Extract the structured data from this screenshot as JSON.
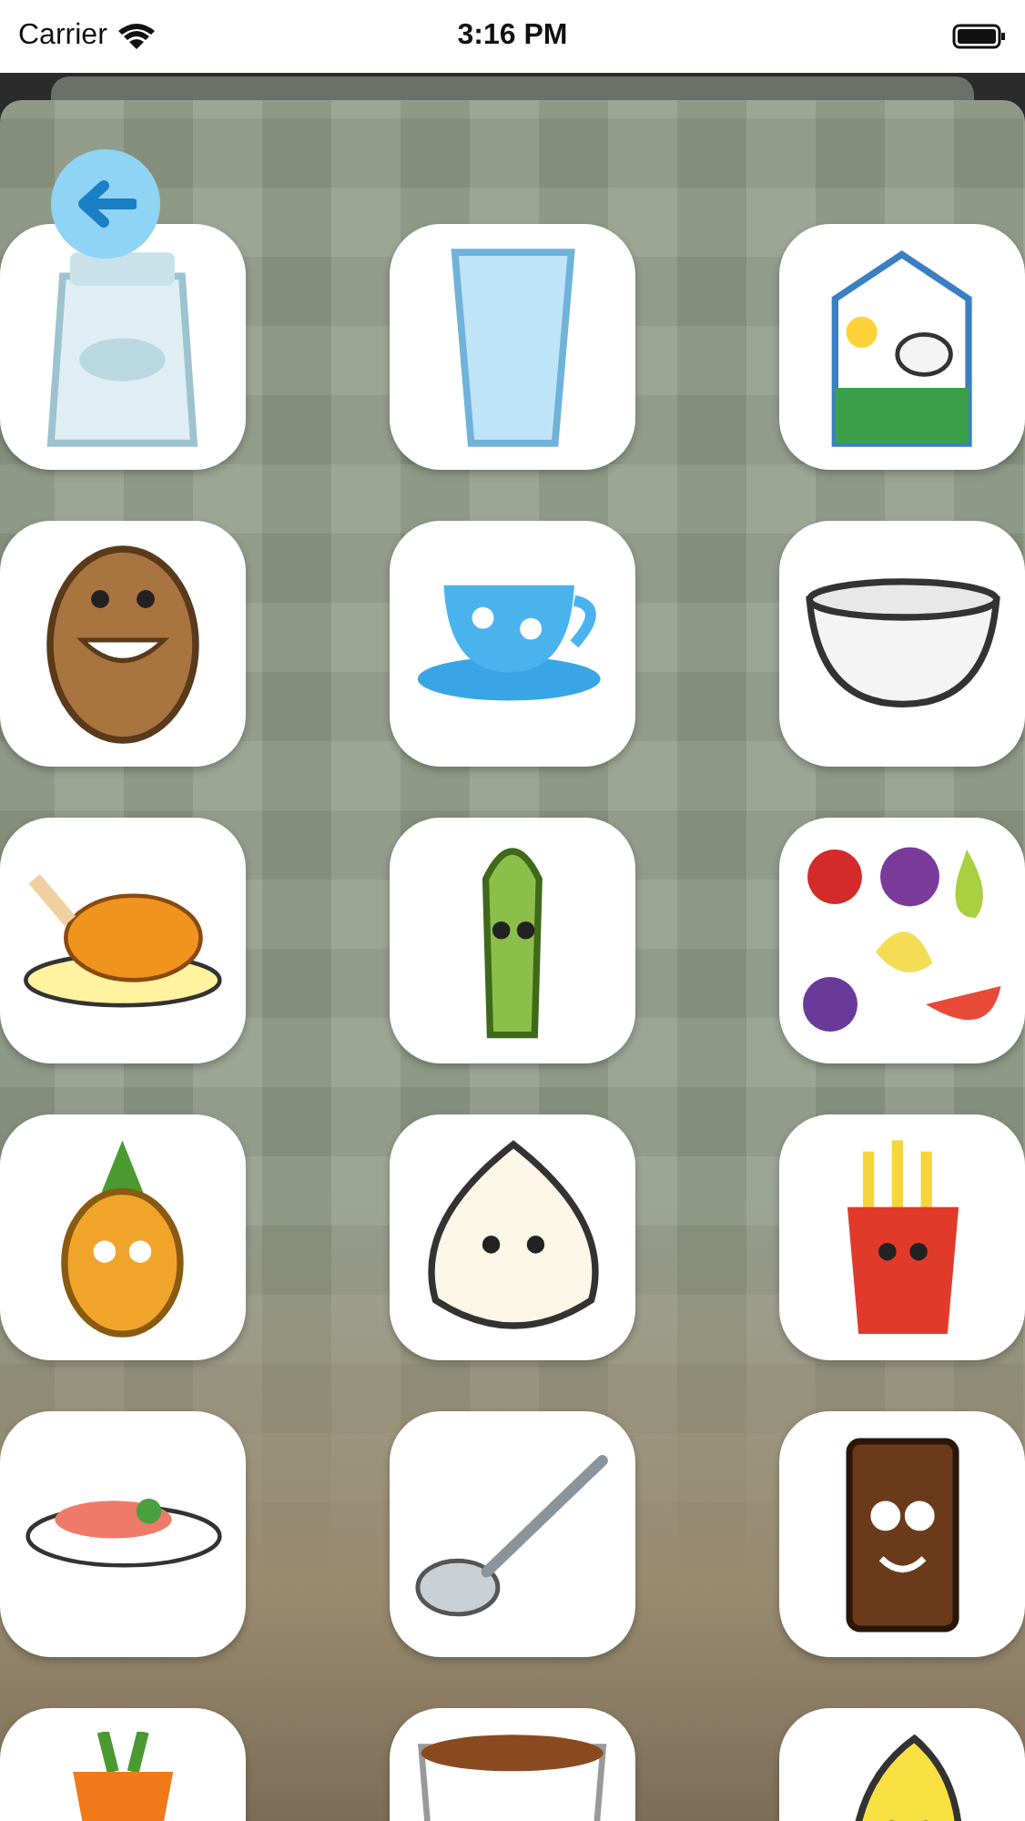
{
  "status_bar": {
    "carrier": "Carrier",
    "time": "3:16 PM"
  },
  "tiles": [
    {
      "kind": "sugar"
    },
    {
      "kind": "glass"
    },
    {
      "kind": "milk"
    },
    {
      "kind": "potato"
    },
    {
      "kind": "teacup"
    },
    {
      "kind": "bowl"
    },
    {
      "kind": "chicken"
    },
    {
      "kind": "asparagus"
    },
    {
      "kind": "fruits"
    },
    {
      "kind": "pineapple"
    },
    {
      "kind": "onion"
    },
    {
      "kind": "fries"
    },
    {
      "kind": "fish"
    },
    {
      "kind": "spoon"
    },
    {
      "kind": "chocolate"
    },
    {
      "kind": "carrot"
    },
    {
      "kind": "coffee"
    },
    {
      "kind": "banana"
    }
  ]
}
